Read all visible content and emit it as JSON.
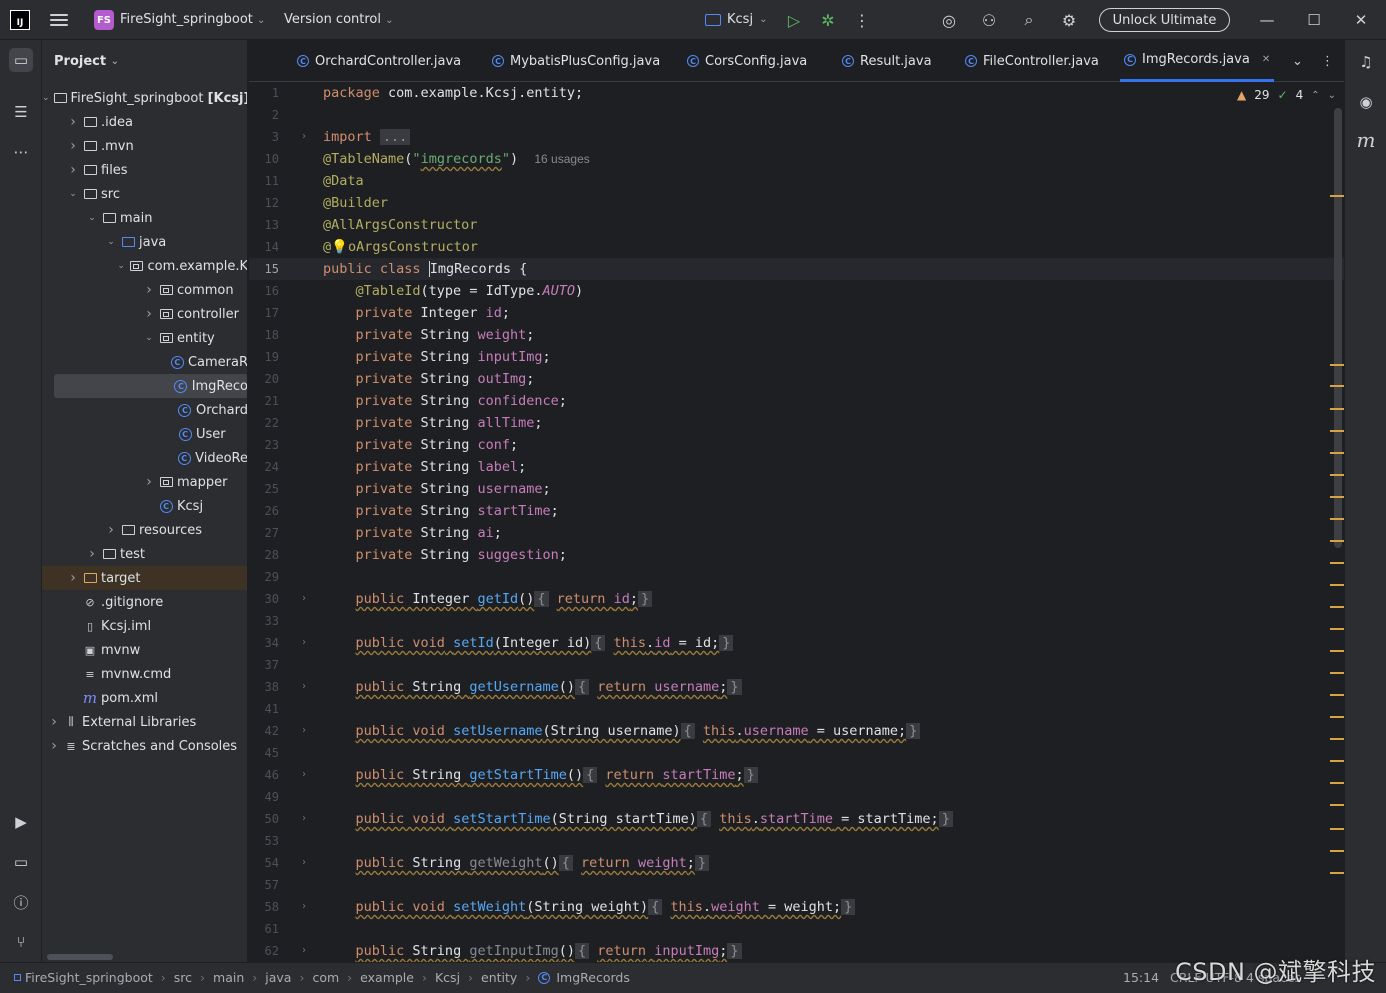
{
  "titlebar": {
    "logo_text": "IJ",
    "project_badge": "FS",
    "project_name": "FireSight_springboot",
    "version_control": "Version control",
    "run_config": "Kcsj",
    "unlock": "Unlock Ultimate"
  },
  "project_panel": {
    "title": "Project",
    "tree": [
      {
        "label": "FireSight_springboot [Kcsj]",
        "icon": "folder",
        "depth": 0,
        "chev": "down"
      },
      {
        "label": ".idea",
        "icon": "folder",
        "depth": 1,
        "chev": "right"
      },
      {
        "label": ".mvn",
        "icon": "folder",
        "depth": 1,
        "chev": "right"
      },
      {
        "label": "files",
        "icon": "folder",
        "depth": 1,
        "chev": "right"
      },
      {
        "label": "src",
        "icon": "folder",
        "depth": 1,
        "chev": "down"
      },
      {
        "label": "main",
        "icon": "folder",
        "depth": 2,
        "chev": "down"
      },
      {
        "label": "java",
        "icon": "folder-blue",
        "depth": 3,
        "chev": "down"
      },
      {
        "label": "com.example.K",
        "icon": "package",
        "depth": 4,
        "chev": "down"
      },
      {
        "label": "common",
        "icon": "package",
        "depth": 5,
        "chev": "right"
      },
      {
        "label": "controller",
        "icon": "package",
        "depth": 5,
        "chev": "right"
      },
      {
        "label": "entity",
        "icon": "package",
        "depth": 5,
        "chev": "down"
      },
      {
        "label": "CameraR",
        "icon": "class",
        "depth": 6,
        "chev": ""
      },
      {
        "label": "ImgReco",
        "icon": "class",
        "depth": 6,
        "chev": "",
        "selected": true
      },
      {
        "label": "Orchard",
        "icon": "class",
        "depth": 6,
        "chev": ""
      },
      {
        "label": "User",
        "icon": "class",
        "depth": 6,
        "chev": ""
      },
      {
        "label": "VideoRe",
        "icon": "class",
        "depth": 6,
        "chev": ""
      },
      {
        "label": "mapper",
        "icon": "package",
        "depth": 5,
        "chev": "right"
      },
      {
        "label": "Kcsj",
        "icon": "class-run",
        "depth": 5,
        "chev": ""
      },
      {
        "label": "resources",
        "icon": "folder-res",
        "depth": 3,
        "chev": "right"
      },
      {
        "label": "test",
        "icon": "folder",
        "depth": 2,
        "chev": "right"
      },
      {
        "label": "target",
        "icon": "folder-orange",
        "depth": 1,
        "chev": "right",
        "highlight": true
      },
      {
        "label": ".gitignore",
        "icon": "gitignore",
        "depth": 1,
        "chev": ""
      },
      {
        "label": "Kcsj.iml",
        "icon": "file",
        "depth": 1,
        "chev": ""
      },
      {
        "label": "mvnw",
        "icon": "terminal",
        "depth": 1,
        "chev": ""
      },
      {
        "label": "mvnw.cmd",
        "icon": "lines",
        "depth": 1,
        "chev": ""
      },
      {
        "label": "pom.xml",
        "icon": "maven",
        "depth": 1,
        "chev": ""
      },
      {
        "label": "External Libraries",
        "icon": "lib",
        "depth": 0,
        "chev": "right"
      },
      {
        "label": "Scratches and Consoles",
        "icon": "scratch",
        "depth": 0,
        "chev": "right"
      }
    ]
  },
  "tabs": [
    {
      "label": "OrchardController.java",
      "active": false
    },
    {
      "label": "MybatisPlusConfig.java",
      "active": false
    },
    {
      "label": "CorsConfig.java",
      "active": false
    },
    {
      "label": "Result.java",
      "active": false
    },
    {
      "label": "FileController.java",
      "active": false
    },
    {
      "label": "ImgRecords.java",
      "active": true
    }
  ],
  "inspections": {
    "warnings": "29",
    "ok": "4"
  },
  "editor": {
    "current_line": 15,
    "lines": [
      {
        "n": "1"
      },
      {
        "n": "2"
      },
      {
        "n": "3"
      },
      {
        "n": "10"
      },
      {
        "n": "11"
      },
      {
        "n": "12"
      },
      {
        "n": "13"
      },
      {
        "n": "14"
      },
      {
        "n": "15"
      },
      {
        "n": "16"
      },
      {
        "n": "17"
      },
      {
        "n": "18"
      },
      {
        "n": "19"
      },
      {
        "n": "20"
      },
      {
        "n": "21"
      },
      {
        "n": "22"
      },
      {
        "n": "23"
      },
      {
        "n": "24"
      },
      {
        "n": "25"
      },
      {
        "n": "26"
      },
      {
        "n": "27"
      },
      {
        "n": "28"
      },
      {
        "n": "29"
      },
      {
        "n": "30"
      },
      {
        "n": "33"
      },
      {
        "n": "34"
      },
      {
        "n": "37"
      },
      {
        "n": "38"
      },
      {
        "n": "41"
      },
      {
        "n": "42"
      },
      {
        "n": "45"
      },
      {
        "n": "46"
      },
      {
        "n": "49"
      },
      {
        "n": "50"
      },
      {
        "n": "53"
      },
      {
        "n": "54"
      },
      {
        "n": "57"
      },
      {
        "n": "58"
      },
      {
        "n": "61"
      },
      {
        "n": "62"
      }
    ],
    "usages_hint": "16 usages",
    "fields": [
      "id",
      "weight",
      "inputImg",
      "outImg",
      "confidence",
      "allTime",
      "conf",
      "label",
      "username",
      "startTime",
      "ai",
      "suggestion"
    ]
  },
  "statusbar": {
    "breadcrumb": [
      "FireSight_springboot",
      "src",
      "main",
      "java",
      "com",
      "example",
      "Kcsj",
      "entity",
      "ImgRecords"
    ],
    "position": "15:14",
    "extra": "CRLF   UTF-8   4 spaces"
  },
  "watermark": "CSDN @斌擎科技",
  "colors": {
    "accent": "#3574f0",
    "keyword": "#cf8e6d",
    "annotation": "#b3ae60",
    "string": "#6aab73",
    "field": "#c77dbb",
    "method": "#56a8f5"
  }
}
